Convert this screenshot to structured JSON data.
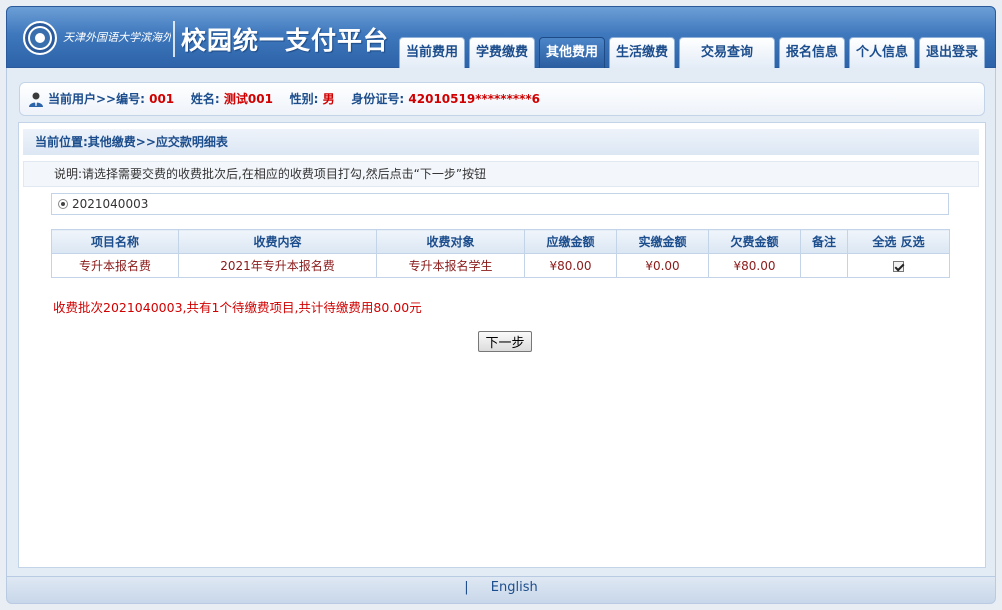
{
  "header": {
    "school_name": "天津外国语大学滨海外事学院",
    "platform_title": "校园统一支付平台",
    "nav_tabs": [
      {
        "label": "当前费用",
        "active": false
      },
      {
        "label": "学费缴费",
        "active": false
      },
      {
        "label": "其他费用",
        "active": true
      },
      {
        "label": "生活缴费",
        "active": false
      },
      {
        "label": "交易查询",
        "active": false
      },
      {
        "label": "报名信息",
        "active": false
      },
      {
        "label": "个人信息",
        "active": false
      },
      {
        "label": "退出登录",
        "active": false
      }
    ]
  },
  "user_bar": {
    "prefix": "当前用户>>编号:",
    "id": "001",
    "name_label": "姓名:",
    "name": "测试001",
    "gender_label": "性别:",
    "gender": "男",
    "idcard_label": "身份证号:",
    "idcard": "42010519*********6"
  },
  "location": "当前位置:其他缴费>>应交款明细表",
  "instruction": "说明:请选择需要交费的收费批次后,在相应的收费项目打勾,然后点击“下一步”按钮",
  "batch": {
    "value": "2021040003",
    "selected": true
  },
  "table": {
    "headers": [
      "项目名称",
      "收费内容",
      "收费对象",
      "应缴金额",
      "实缴金额",
      "欠费金额",
      "备注",
      "全选 反选"
    ],
    "rows": [
      {
        "cells": [
          "专升本报名费",
          "2021年专升本报名费",
          "专升本报名学生",
          "¥80.00",
          "¥0.00",
          "¥80.00",
          ""
        ],
        "checked": true
      }
    ]
  },
  "summary": "收费批次2021040003,共有1个待缴费项目,共计待缴费用80.00元",
  "next_button": "下一步",
  "footer": {
    "separator": "|",
    "english_link": "English"
  },
  "colors": {
    "accent": "#2d63a8",
    "highlight": "#d00000",
    "header_text": "#1c4d8c"
  }
}
